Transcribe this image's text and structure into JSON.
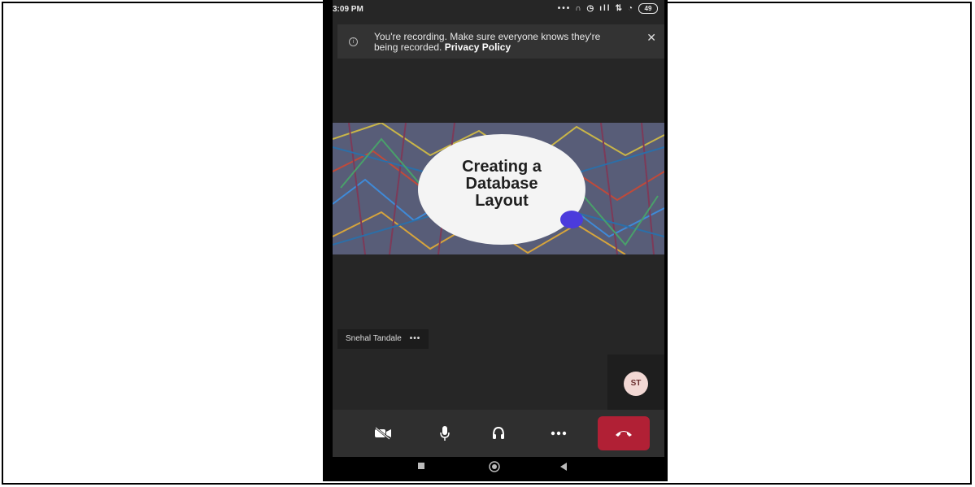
{
  "status_bar": {
    "time": "3:09 PM",
    "icons": [
      "more-dots-icon",
      "headset-icon",
      "alarm-icon",
      "signal-icon",
      "data-icon",
      "wifi-icon"
    ],
    "battery": "49"
  },
  "banner": {
    "message": "You're recording. Make sure everyone knows they're being recorded.",
    "link": "Privacy Policy",
    "close": "✕"
  },
  "slide": {
    "title_line1": "Creating a",
    "title_line2": "Database",
    "title_line3": "Layout",
    "accent_color": "#4b3bdc"
  },
  "participant": {
    "name": "Snehal Tandale",
    "more": "•••"
  },
  "self_view": {
    "initials": "ST"
  },
  "controls": {
    "camera": "camera-off-icon",
    "mic": "microphone-icon",
    "audio": "headphones-icon",
    "more": "more-options-icon",
    "hangup": "hang-up-icon",
    "hangup_color": "#b12035"
  }
}
